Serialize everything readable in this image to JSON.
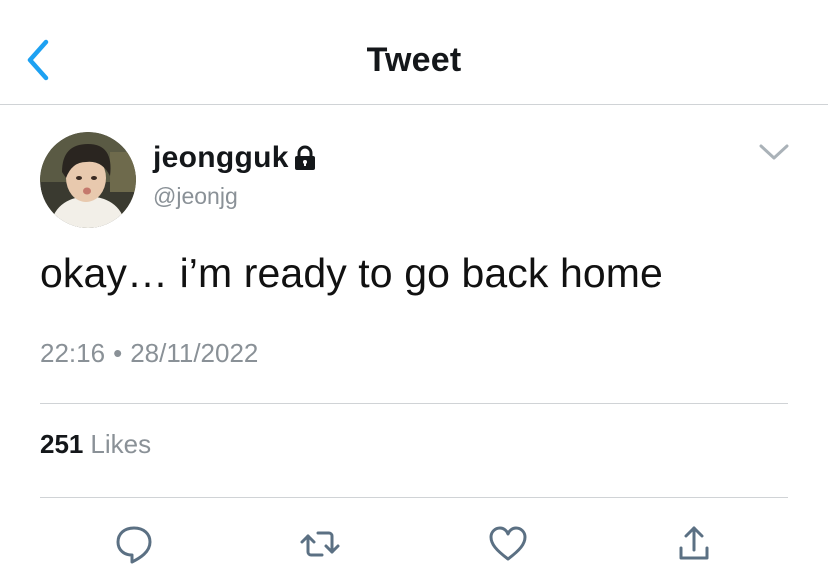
{
  "header": {
    "title": "Tweet",
    "back_icon": "chevron-left-icon",
    "accent": "#1da1f2"
  },
  "author": {
    "display_name": "jeongguk",
    "handle": "@jeonjg",
    "protected_icon": "lock-icon"
  },
  "tweet": {
    "text": "okay… i’m ready to go back home",
    "time": "22:16",
    "separator": "•",
    "date": "28/11/2022"
  },
  "stats": {
    "likes_count": "251",
    "likes_label": "Likes"
  },
  "actions": [
    "reply-icon",
    "retweet-icon",
    "like-icon",
    "share-icon"
  ],
  "colors": {
    "text": "#14171a",
    "secondary": "#8a9197",
    "icon": "#5b7083",
    "divider": "#d0d3d6"
  }
}
